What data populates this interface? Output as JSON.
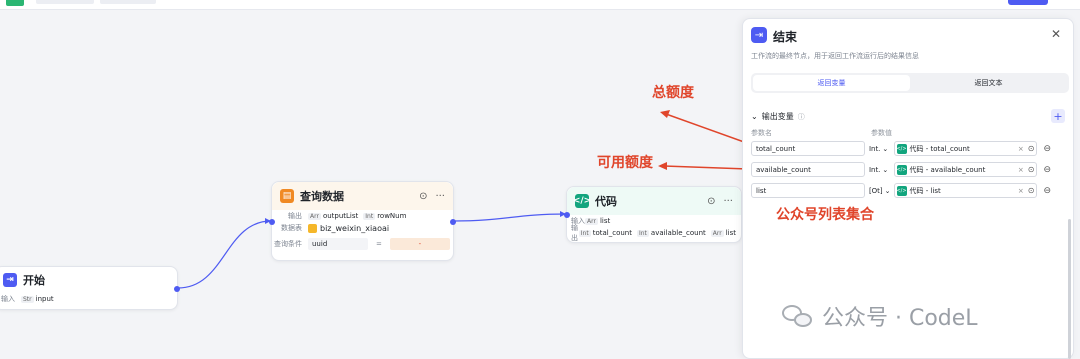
{
  "start_node": {
    "title": "开始",
    "input_label": "输入",
    "input_type": "Str",
    "input_name": "input"
  },
  "query_node": {
    "title": "查询数据",
    "output_label": "输出",
    "outputs": [
      {
        "type": "Arr",
        "name": "outputList"
      },
      {
        "type": "Int",
        "name": "rowNum"
      }
    ],
    "table_label": "数据表",
    "table_name": "biz_weixin_xiaoai",
    "condition_label": "查询条件",
    "condition_field": "uuid",
    "condition_op": "=",
    "condition_value": "-"
  },
  "code_node": {
    "title": "代码",
    "input_label": "输入",
    "input_type": "Arr",
    "input_name": "list",
    "output_label": "输出",
    "outputs": [
      {
        "type": "Int",
        "name": "total_count"
      },
      {
        "type": "Int",
        "name": "available_count"
      },
      {
        "type": "Arr",
        "name": "list"
      }
    ]
  },
  "panel": {
    "title": "结束",
    "description": "工作流的最终节点，用于返回工作流运行后的结果信息",
    "tabs": [
      "返回变量",
      "返回文本"
    ],
    "section_title": "输出变量",
    "col_name": "参数名",
    "col_value": "参数值",
    "rows": [
      {
        "name": "total_count",
        "type": "Int.",
        "ref": "代码 - total_count"
      },
      {
        "name": "available_count",
        "type": "Int.",
        "ref": "代码 - available_count"
      },
      {
        "name": "list",
        "type": "[Ot]",
        "ref": "代码 - list"
      }
    ]
  },
  "annotations": {
    "total": "总额度",
    "available": "可用额度",
    "list": "公众号列表集合"
  },
  "watermark": "公众号 · CodeL",
  "colors": {
    "accent": "#4e5bf2",
    "annotation": "#e0452b",
    "code_green": "#12a57e",
    "query_orange": "#f08a24"
  }
}
